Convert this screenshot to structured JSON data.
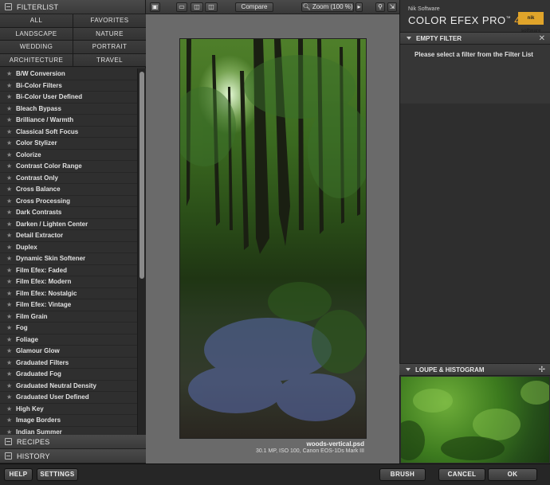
{
  "left_panel": {
    "filterlist_title": "FILTERLIST",
    "categories": [
      "ALL",
      "FAVORITES",
      "LANDSCAPE",
      "NATURE",
      "WEDDING",
      "PORTRAIT",
      "ARCHITECTURE",
      "TRAVEL"
    ],
    "filters": [
      "B/W Conversion",
      "Bi-Color Filters",
      "Bi-Color User Defined",
      "Bleach Bypass",
      "Brilliance / Warmth",
      "Classical Soft Focus",
      "Color Stylizer",
      "Colorize",
      "Contrast Color Range",
      "Contrast Only",
      "Cross Balance",
      "Cross Processing",
      "Dark Contrasts",
      "Darken / Lighten Center",
      "Detail Extractor",
      "Duplex",
      "Dynamic Skin Softener",
      "Film Efex: Faded",
      "Film Efex: Modern",
      "Film Efex: Nostalgic",
      "Film Efex: Vintage",
      "Film Grain",
      "Fog",
      "Foliage",
      "Glamour Glow",
      "Graduated Filters",
      "Graduated Fog",
      "Graduated Neutral Density",
      "Graduated User Defined",
      "High Key",
      "Image Borders",
      "Indian Summer"
    ],
    "recipes_label": "RECIPES",
    "history_label": "HISTORY"
  },
  "toolbar": {
    "compare_label": "Compare",
    "zoom_label": "Zoom (100 %)"
  },
  "preview": {
    "filename": "woods-vertical.psd",
    "meta": "30.1 MP, ISO 100, Canon EOS-1Ds Mark III"
  },
  "right_panel": {
    "brand_small": "Nik Software",
    "brand_name": "COLOR EFEX PRO",
    "brand_tm": "™",
    "brand_version": "4",
    "logo_text": "nik software",
    "empty_filter_title": "EMPTY FILTER",
    "empty_filter_message": "Please select a filter from the Filter List",
    "loupe_title": "LOUPE & HISTOGRAM"
  },
  "bottom": {
    "help": "HELP",
    "settings": "SETTINGS",
    "brush": "BRUSH",
    "cancel": "CANCEL",
    "ok": "OK"
  }
}
